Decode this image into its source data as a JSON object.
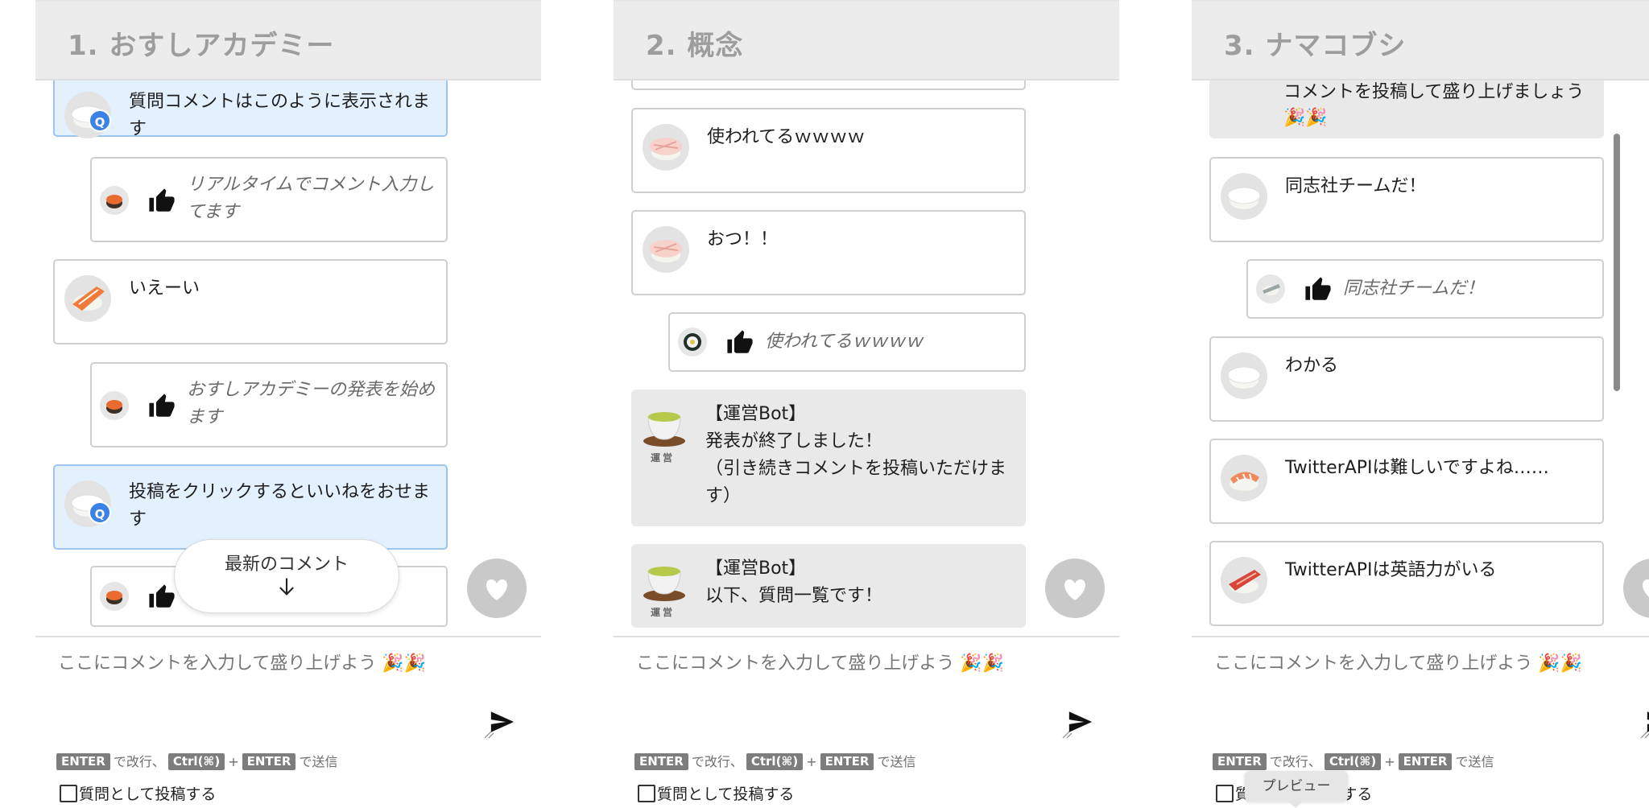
{
  "panels": [
    {
      "title": "1. おすしアカデミー",
      "messages": [
        {
          "kind": "question",
          "text": "質問コメントはこのように表示されます",
          "badge": "Q"
        },
        {
          "kind": "like",
          "text": "リアルタイムでコメント入力してます"
        },
        {
          "kind": "comment",
          "text": "いえーい"
        },
        {
          "kind": "like",
          "text": "おすしアカデミーの発表を始めます"
        },
        {
          "kind": "question",
          "text": "投稿をクリックするといいねをおせます",
          "badge": "Q"
        },
        {
          "kind": "like",
          "text": ""
        }
      ],
      "latest_button": "最新のコメント"
    },
    {
      "title": "2. 概念",
      "messages": [
        {
          "kind": "comment",
          "text": "使われてるｗｗｗｗ"
        },
        {
          "kind": "comment",
          "text": "おつ！！"
        },
        {
          "kind": "like",
          "text": "使われてるｗｗｗｗ"
        },
        {
          "kind": "bot",
          "text": "【運営Bot】\n発表が終了しました！\n（引き続きコメントを投稿いただけます）",
          "lines": [
            "【運営Bot】",
            "発表が終了しました！",
            "（引き続きコメントを投稿いただけま",
            "す）"
          ],
          "label": "運営"
        },
        {
          "kind": "bot",
          "lines": [
            "【運営Bot】",
            "以下、質問一覧です！"
          ],
          "label": "運営"
        }
      ]
    },
    {
      "title": "3. ナマコブシ",
      "messages": [
        {
          "kind": "bot",
          "lines": [
            "コメントを投稿して盛り上げましょう",
            "🎉🎉"
          ]
        },
        {
          "kind": "comment",
          "text": "同志社チームだ！"
        },
        {
          "kind": "like",
          "text": "同志社チームだ！"
        },
        {
          "kind": "comment",
          "text": "わかる"
        },
        {
          "kind": "comment",
          "text": "TwitterAPIは難しいですよね……"
        },
        {
          "kind": "comment",
          "text": "TwitterAPIは英語力がいる"
        }
      ]
    }
  ],
  "composer": {
    "placeholder": "ここにコメントを入力して盛り上げよう 🎉🎉",
    "key_enter": "ENTER",
    "newline_text": "で改行、",
    "key_ctrl": "Ctrl(⌘)",
    "plus": "+",
    "send_text": "で送信",
    "question_checkbox_label": "質問として投稿する"
  },
  "tooltip": "プレビュー",
  "colors": {
    "header_bg": "#ececec",
    "question_bg": "#e3f0fd",
    "question_border": "#9cc6ef",
    "bot_bg": "#e9e9e9",
    "heart_button": "#c9c9c9",
    "q_badge": "#3b82e6"
  },
  "icons": [
    "heart-icon",
    "send-icon",
    "thumbs-up-icon",
    "arrow-down-icon",
    "sushi-avatar-icon",
    "tea-cup-icon",
    "q-badge-icon",
    "resize-grip-icon"
  ]
}
